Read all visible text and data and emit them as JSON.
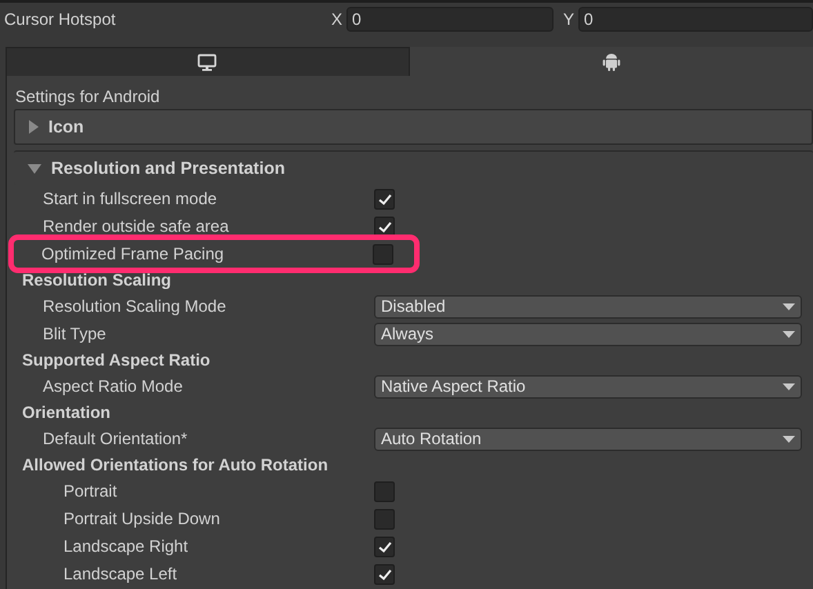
{
  "cursor_hotspot": {
    "label": "Cursor Hotspot",
    "fields": [
      {
        "axis": "X",
        "value": "0"
      },
      {
        "axis": "Y",
        "value": "0"
      }
    ]
  },
  "platform_tabs": [
    {
      "kind": "desktop",
      "selected": false
    },
    {
      "kind": "android",
      "selected": true
    }
  ],
  "settings_title": "Settings for Android",
  "sections": [
    {
      "title": "Icon",
      "expanded": false
    },
    {
      "title": "Resolution and Presentation",
      "expanded": true,
      "items": [
        {
          "kind": "checkbox",
          "label": "Start in fullscreen mode",
          "checked": true,
          "highlighted": false
        },
        {
          "kind": "checkbox",
          "label": "Render outside safe area",
          "checked": true,
          "highlighted": false
        },
        {
          "kind": "checkbox",
          "label": "Optimized Frame Pacing",
          "checked": false,
          "highlighted": true
        },
        {
          "kind": "heading",
          "label": "Resolution Scaling",
          "children": [
            {
              "kind": "dropdown",
              "label": "Resolution Scaling Mode",
              "value": "Disabled"
            },
            {
              "kind": "dropdown",
              "label": "Blit Type",
              "value": "Always"
            }
          ]
        },
        {
          "kind": "heading",
          "label": "Supported Aspect Ratio",
          "children": [
            {
              "kind": "dropdown",
              "label": "Aspect Ratio Mode",
              "value": "Native Aspect Ratio"
            }
          ]
        },
        {
          "kind": "heading",
          "label": "Orientation",
          "children": [
            {
              "kind": "dropdown",
              "label": "Default Orientation*",
              "value": "Auto Rotation"
            }
          ]
        },
        {
          "kind": "heading",
          "label": "Allowed Orientations for Auto Rotation",
          "children": [
            {
              "kind": "checkbox",
              "label": "Portrait",
              "checked": false
            },
            {
              "kind": "checkbox",
              "label": "Portrait Upside Down",
              "checked": false
            },
            {
              "kind": "checkbox",
              "label": "Landscape Right",
              "checked": true
            },
            {
              "kind": "checkbox",
              "label": "Landscape Left",
              "checked": true
            }
          ]
        }
      ]
    }
  ]
}
